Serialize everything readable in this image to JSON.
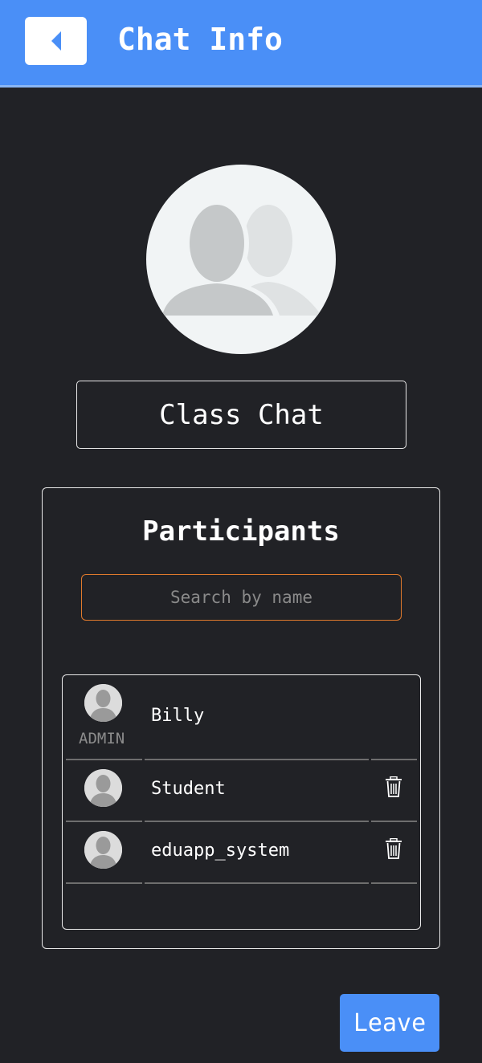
{
  "header": {
    "title": "Chat Info",
    "back_icon": "back-arrow-icon",
    "color": "#4a8ff7"
  },
  "group": {
    "avatar_icon": "group-avatar-icon",
    "name": "Class Chat"
  },
  "participants": {
    "title": "Participants",
    "search": {
      "placeholder": "Search by name",
      "value": ""
    },
    "items": [
      {
        "name": "Billy",
        "role": "ADMIN",
        "removable": false
      },
      {
        "name": "Student",
        "role": "",
        "removable": true
      },
      {
        "name": "eduapp_system",
        "role": "",
        "removable": true
      }
    ]
  },
  "actions": {
    "leave_label": "Leave"
  }
}
